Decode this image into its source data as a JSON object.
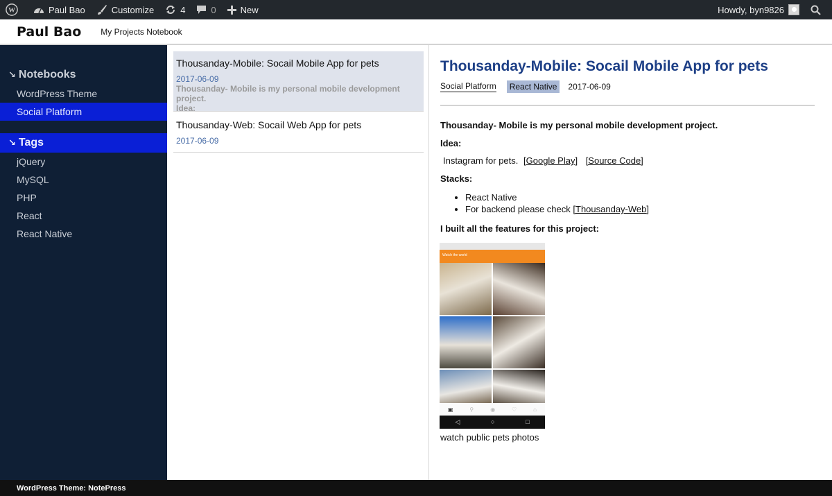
{
  "adminbar": {
    "site_name": "Paul Bao",
    "customize": "Customize",
    "updates_count": "4",
    "comments_count": "0",
    "new_label": "New",
    "howdy": "Howdy, byn9826"
  },
  "header": {
    "site_title": "Paul Bao",
    "site_description": "My Projects Notebook"
  },
  "sidebar": {
    "notebooks_heading": "Notebooks",
    "notebooks": [
      {
        "label": "WordPress Theme"
      },
      {
        "label": "Social Platform"
      }
    ],
    "tags_heading": "Tags",
    "tags": [
      {
        "label": "jQuery"
      },
      {
        "label": "MySQL"
      },
      {
        "label": "PHP"
      },
      {
        "label": "React"
      },
      {
        "label": "React Native"
      }
    ]
  },
  "notes": [
    {
      "title": "Thousanday-Mobile: Socail Mobile App for pets",
      "date": "2017-06-09",
      "excerpt1": "Thousanday- Mobile is my personal mobile development project.",
      "excerpt2": "Idea:"
    },
    {
      "title": "Thousanday-Web: Socail Web App for pets",
      "date": "2017-06-09"
    }
  ],
  "detail": {
    "title": "Thousanday-Mobile: Socail Mobile App for pets",
    "tag1": "Social Platform",
    "tag2": "React Native",
    "date": "2017-06-09",
    "intro": "Thousanday- Mobile is my personal mobile development project.",
    "idea_heading": "Idea:",
    "idea_text": "Instagram for pets.",
    "link_google_play": "[Google Play]",
    "link_source_code": "[Source Code]",
    "stacks_heading": "Stacks:",
    "stack1": "React Native",
    "stack2_prefix": "For backend please check",
    "stack2_link": "[Thousanday-Web]",
    "features_heading": "I built all the features for this project:",
    "phone_bar_text": "Watch the world",
    "caption": "watch public pets photos"
  },
  "footer": {
    "text": "WordPress Theme: NotePress"
  }
}
